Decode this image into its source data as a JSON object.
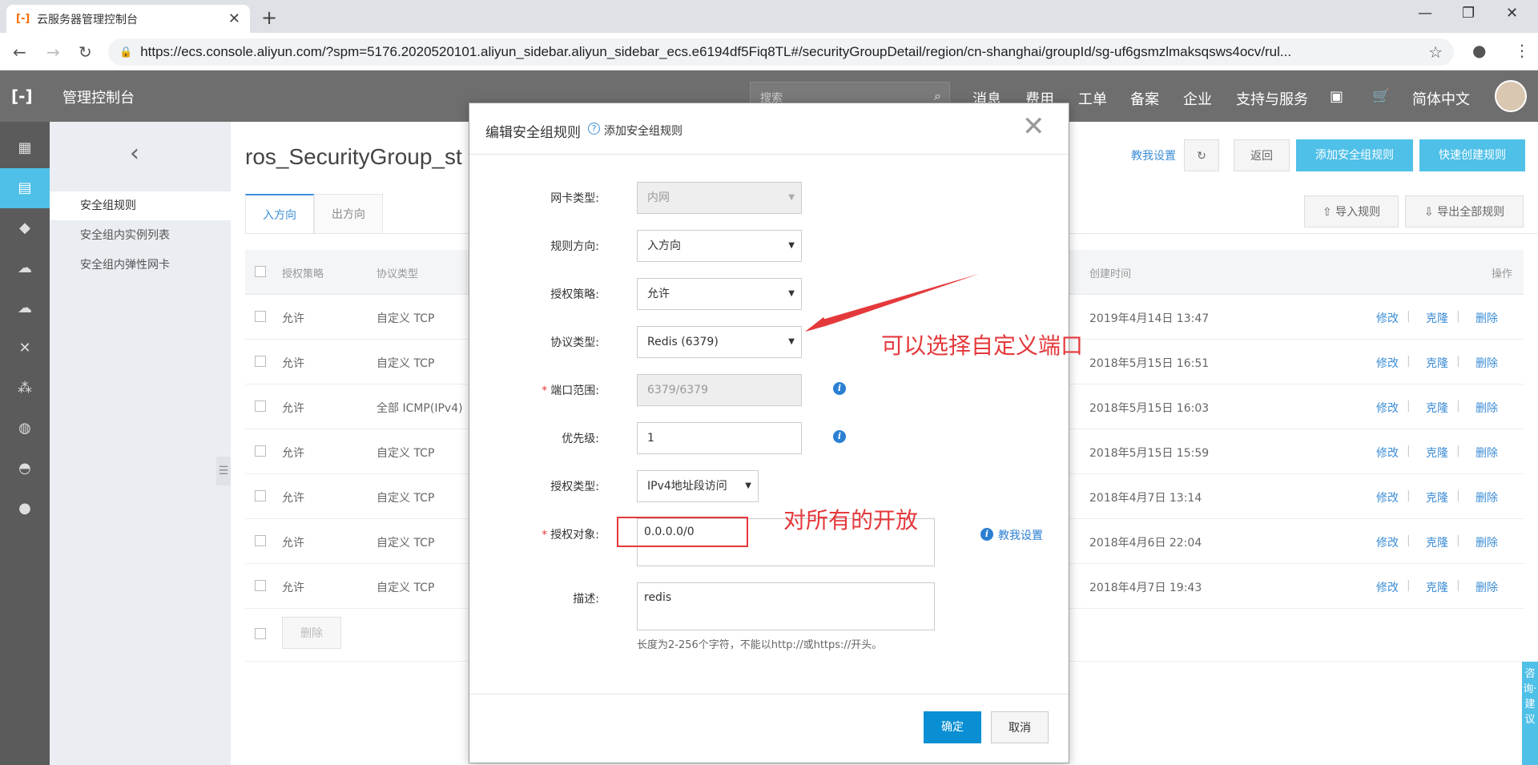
{
  "browser": {
    "tab_title": "云服务器管理控制台",
    "url": "https://ecs.console.aliyun.com/?spm=5176.2020520101.aliyun_sidebar.aliyun_sidebar_ecs.e6194df5Fiq8TL#/securityGroupDetail/region/cn-shanghai/groupId/sg-uf6gsmzlmaksqsws4ocv/rul..."
  },
  "topnav": {
    "logo": "[-]",
    "brand": "管理控制台",
    "search_placeholder": "搜索",
    "items": [
      "消息",
      "费用",
      "工单",
      "备案",
      "企业",
      "支持与服务"
    ],
    "language": "简体中文"
  },
  "subnav": {
    "items": [
      "安全组规则",
      "安全组内实例列表",
      "安全组内弹性网卡"
    ]
  },
  "page": {
    "title": "ros_SecurityGroup_st",
    "help_link": "教我设置",
    "back_btn": "返回",
    "add_rule_btn": "添加安全组规则",
    "quick_rule_btn": "快速创建规则",
    "import_btn": "导入规则",
    "export_btn": "导出全部规则",
    "tabs": [
      "入方向",
      "出方向"
    ],
    "delete_btn": "删除"
  },
  "table": {
    "headers": {
      "policy": "授权策略",
      "protocol": "协议类型",
      "created": "创建时间",
      "ops": "操作"
    },
    "rows": [
      {
        "policy": "允许",
        "protocol": "自定义 TCP",
        "created": "2019年4月14日 13:47"
      },
      {
        "policy": "允许",
        "protocol": "自定义 TCP",
        "created": "2018年5月15日 16:51"
      },
      {
        "policy": "允许",
        "protocol": "全部 ICMP(IPv4)",
        "created": "2018年5月15日 16:03"
      },
      {
        "policy": "允许",
        "protocol": "自定义 TCP",
        "created": "2018年5月15日 15:59"
      },
      {
        "policy": "允许",
        "protocol": "自定义 TCP",
        "created": "2018年4月7日 13:14"
      },
      {
        "policy": "允许",
        "protocol": "自定义 TCP",
        "created": "2018年4月6日 22:04"
      },
      {
        "policy": "允许",
        "protocol": "自定义 TCP",
        "created": "2018年4月7日 19:43"
      }
    ],
    "actions": {
      "edit": "修改",
      "clone": "克隆",
      "delete": "删除"
    }
  },
  "modal": {
    "title": "编辑安全组规则",
    "subtitle": "添加安全组规则",
    "fields": {
      "nic_label": "网卡类型:",
      "nic_value": "内网",
      "dir_label": "规则方向:",
      "dir_value": "入方向",
      "policy_label": "授权策略:",
      "policy_value": "允许",
      "protocol_label": "协议类型:",
      "protocol_value": "Redis (6379)",
      "port_label": "端口范围:",
      "port_value": "6379/6379",
      "priority_label": "优先级:",
      "priority_value": "1",
      "authtype_label": "授权类型:",
      "authtype_value": "IPv4地址段访问",
      "target_label": "授权对象:",
      "target_value": "0.0.0.0/0",
      "target_help": "教我设置",
      "desc_label": "描述:",
      "desc_value": "redis",
      "desc_hint": "长度为2-256个字符，不能以http://或https://开头。"
    },
    "ok_btn": "确定",
    "cancel_btn": "取消"
  },
  "annotations": {
    "custom_port": "可以选择自定义端口",
    "open_all": "对所有的开放"
  },
  "float_bar": "咨询·建议",
  "colors": {
    "accent": "#4fc0e8",
    "link": "#3c8dd6",
    "annotation": "#e4393c",
    "primary_btn": "#0a8fd4"
  }
}
